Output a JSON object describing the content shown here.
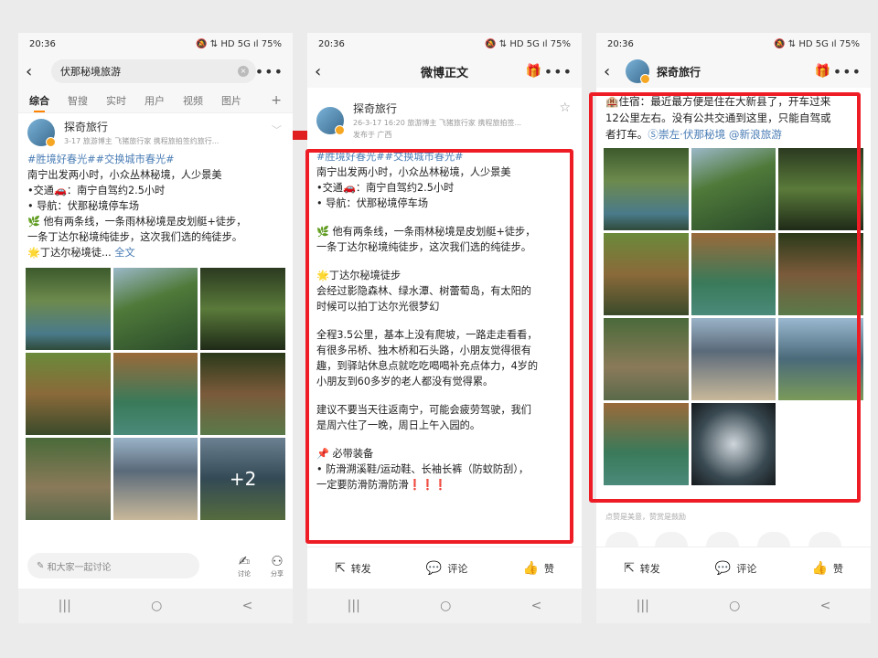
{
  "status": {
    "time": "20:36",
    "battery": "75%",
    "icons_left": "◎ ✉ ☑",
    "icons_right": "🔕 ⇅ HD 5G ıl"
  },
  "p1": {
    "search": "伏那秘境旅游",
    "tabs": [
      "综合",
      "智搜",
      "实时",
      "用户",
      "视频",
      "图片"
    ],
    "plus": "+",
    "author": {
      "name": "探奇旅行",
      "meta": "3-17  旅游博主 飞猪旅行家 携程旅拍签约旅行..."
    },
    "tags": "#胜境好春光##交换城市春光#",
    "lines": [
      "南宁出发两小时，小众丛林秘境，人少景美",
      "•交通🚗：南宁自驾约2.5小时",
      "• 导航：伏那秘境停车场",
      "🌿 他有两条线，一条雨林秘境是皮划艇+徒步，",
      "一条丁达尔秘境纯徒步，这次我们选的纯徒步。"
    ],
    "last_line": "🌟丁达尔秘境徒...",
    "fulltext": "全文",
    "more_photos": "+2",
    "comment_placeholder": "和大家一起讨论",
    "act_comment": "讨论",
    "act_share": "分享"
  },
  "p2": {
    "title": "微博正文",
    "author": {
      "name": "探奇旅行",
      "meta": "26-3-17 16:20  旅游博主 飞猪旅行家 携程旅拍签...",
      "posted": "发布于 广西"
    },
    "tags": "#胜境好春光##交换城市春光#",
    "para1": [
      "南宁出发两小时，小众丛林秘境，人少景美",
      "•交通🚗：南宁自驾约2.5小时",
      "• 导航：伏那秘境停车场"
    ],
    "para2": [
      "🌿 他有两条线，一条雨林秘境是皮划艇+徒步，",
      "一条丁达尔秘境纯徒步，这次我们选的纯徒步。"
    ],
    "para3": [
      "🌟丁达尔秘境徒步",
      "会经过影隐森林、绿水潭、树蕾萄岛，有太阳的",
      "时候可以拍丁达尔光很梦幻"
    ],
    "para4": [
      "全程3.5公里，基本上没有爬坡，一路走走看看，",
      "有很多吊桥、独木桥和石头路，小朋友觉得很有",
      "趣，到驿站休息点就吃吃喝喝补充点体力，4岁的",
      "小朋友到60多岁的老人都没有觉得累。"
    ],
    "para5": [
      "建议不要当天往返南宁，可能会疲劳驾驶，我们",
      "是周六住了一晚，周日上午入园的。"
    ],
    "para6": [
      "📌 必带装备",
      "• 防滑溯溪鞋/运动鞋、长袖长裤（防蚊防刮），",
      "一定要防滑防滑防滑❗❗❗"
    ],
    "actions": {
      "repost": "转发",
      "comment": "评论",
      "like": "赞"
    }
  },
  "p3": {
    "title": "探奇旅行",
    "lines": [
      "🏨住宿：最近最方便是住在大新县了，开车过来",
      "12公里左右。没有公共交通到这里，只能自驾或"
    ],
    "line3_text": "者打车。",
    "location": "Ⓢ崇左·伏那秘境",
    "mention": "@新浪旅游",
    "likes_note": "点赞是美意，赞赏是鼓励",
    "actions": {
      "repost": "转发",
      "comment": "评论",
      "like": "赞"
    }
  },
  "sysnav": {
    "recent": "|||",
    "home": "○",
    "back": "<"
  },
  "highlight_color": "#ee1c25",
  "link_color": "#4a7db5"
}
